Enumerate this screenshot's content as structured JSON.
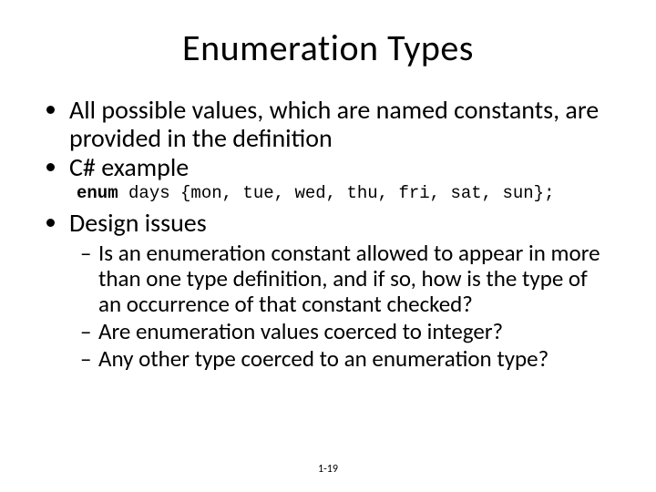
{
  "title": "Enumeration Types",
  "bullets": {
    "b0": "All possible values, which are named constants, are provided in the definition",
    "b1": "C# example",
    "b2": "Design issues"
  },
  "code": {
    "kw": "enum",
    "rest": " days {mon, tue, wed, thu, fri, sat, sun};"
  },
  "sub": {
    "s0": "Is an enumeration constant allowed to appear in more than one type definition, and if so, how is the type of an occurrence of that constant checked?",
    "s1": "Are enumeration values coerced to integer?",
    "s2": "Any other type coerced to an enumeration type?"
  },
  "footer": "1-19"
}
